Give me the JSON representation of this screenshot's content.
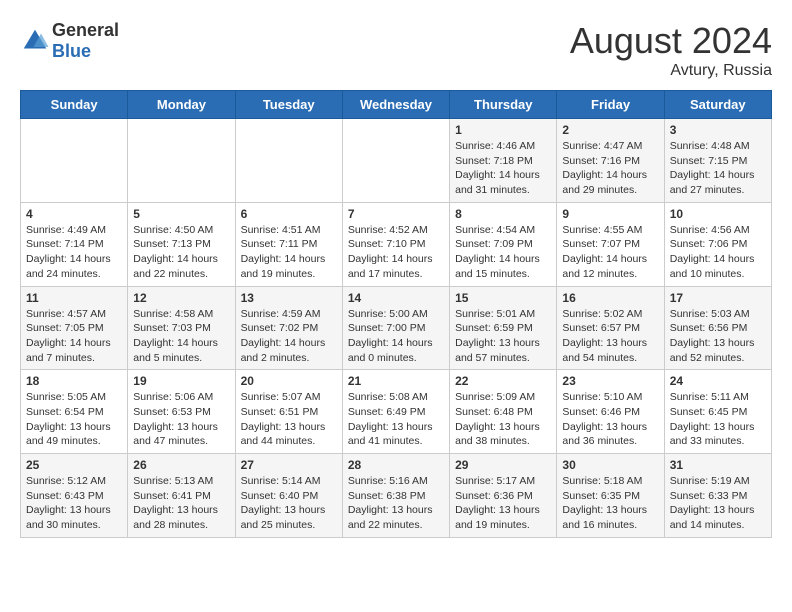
{
  "header": {
    "logo_general": "General",
    "logo_blue": "Blue",
    "month_year": "August 2024",
    "location": "Avtury, Russia"
  },
  "days_of_week": [
    "Sunday",
    "Monday",
    "Tuesday",
    "Wednesday",
    "Thursday",
    "Friday",
    "Saturday"
  ],
  "weeks": [
    [
      {
        "day": "",
        "content": ""
      },
      {
        "day": "",
        "content": ""
      },
      {
        "day": "",
        "content": ""
      },
      {
        "day": "",
        "content": ""
      },
      {
        "day": "1",
        "content": "Sunrise: 4:46 AM\nSunset: 7:18 PM\nDaylight: 14 hours\nand 31 minutes."
      },
      {
        "day": "2",
        "content": "Sunrise: 4:47 AM\nSunset: 7:16 PM\nDaylight: 14 hours\nand 29 minutes."
      },
      {
        "day": "3",
        "content": "Sunrise: 4:48 AM\nSunset: 7:15 PM\nDaylight: 14 hours\nand 27 minutes."
      }
    ],
    [
      {
        "day": "4",
        "content": "Sunrise: 4:49 AM\nSunset: 7:14 PM\nDaylight: 14 hours\nand 24 minutes."
      },
      {
        "day": "5",
        "content": "Sunrise: 4:50 AM\nSunset: 7:13 PM\nDaylight: 14 hours\nand 22 minutes."
      },
      {
        "day": "6",
        "content": "Sunrise: 4:51 AM\nSunset: 7:11 PM\nDaylight: 14 hours\nand 19 minutes."
      },
      {
        "day": "7",
        "content": "Sunrise: 4:52 AM\nSunset: 7:10 PM\nDaylight: 14 hours\nand 17 minutes."
      },
      {
        "day": "8",
        "content": "Sunrise: 4:54 AM\nSunset: 7:09 PM\nDaylight: 14 hours\nand 15 minutes."
      },
      {
        "day": "9",
        "content": "Sunrise: 4:55 AM\nSunset: 7:07 PM\nDaylight: 14 hours\nand 12 minutes."
      },
      {
        "day": "10",
        "content": "Sunrise: 4:56 AM\nSunset: 7:06 PM\nDaylight: 14 hours\nand 10 minutes."
      }
    ],
    [
      {
        "day": "11",
        "content": "Sunrise: 4:57 AM\nSunset: 7:05 PM\nDaylight: 14 hours\nand 7 minutes."
      },
      {
        "day": "12",
        "content": "Sunrise: 4:58 AM\nSunset: 7:03 PM\nDaylight: 14 hours\nand 5 minutes."
      },
      {
        "day": "13",
        "content": "Sunrise: 4:59 AM\nSunset: 7:02 PM\nDaylight: 14 hours\nand 2 minutes."
      },
      {
        "day": "14",
        "content": "Sunrise: 5:00 AM\nSunset: 7:00 PM\nDaylight: 14 hours\nand 0 minutes."
      },
      {
        "day": "15",
        "content": "Sunrise: 5:01 AM\nSunset: 6:59 PM\nDaylight: 13 hours\nand 57 minutes."
      },
      {
        "day": "16",
        "content": "Sunrise: 5:02 AM\nSunset: 6:57 PM\nDaylight: 13 hours\nand 54 minutes."
      },
      {
        "day": "17",
        "content": "Sunrise: 5:03 AM\nSunset: 6:56 PM\nDaylight: 13 hours\nand 52 minutes."
      }
    ],
    [
      {
        "day": "18",
        "content": "Sunrise: 5:05 AM\nSunset: 6:54 PM\nDaylight: 13 hours\nand 49 minutes."
      },
      {
        "day": "19",
        "content": "Sunrise: 5:06 AM\nSunset: 6:53 PM\nDaylight: 13 hours\nand 47 minutes."
      },
      {
        "day": "20",
        "content": "Sunrise: 5:07 AM\nSunset: 6:51 PM\nDaylight: 13 hours\nand 44 minutes."
      },
      {
        "day": "21",
        "content": "Sunrise: 5:08 AM\nSunset: 6:49 PM\nDaylight: 13 hours\nand 41 minutes."
      },
      {
        "day": "22",
        "content": "Sunrise: 5:09 AM\nSunset: 6:48 PM\nDaylight: 13 hours\nand 38 minutes."
      },
      {
        "day": "23",
        "content": "Sunrise: 5:10 AM\nSunset: 6:46 PM\nDaylight: 13 hours\nand 36 minutes."
      },
      {
        "day": "24",
        "content": "Sunrise: 5:11 AM\nSunset: 6:45 PM\nDaylight: 13 hours\nand 33 minutes."
      }
    ],
    [
      {
        "day": "25",
        "content": "Sunrise: 5:12 AM\nSunset: 6:43 PM\nDaylight: 13 hours\nand 30 minutes."
      },
      {
        "day": "26",
        "content": "Sunrise: 5:13 AM\nSunset: 6:41 PM\nDaylight: 13 hours\nand 28 minutes."
      },
      {
        "day": "27",
        "content": "Sunrise: 5:14 AM\nSunset: 6:40 PM\nDaylight: 13 hours\nand 25 minutes."
      },
      {
        "day": "28",
        "content": "Sunrise: 5:16 AM\nSunset: 6:38 PM\nDaylight: 13 hours\nand 22 minutes."
      },
      {
        "day": "29",
        "content": "Sunrise: 5:17 AM\nSunset: 6:36 PM\nDaylight: 13 hours\nand 19 minutes."
      },
      {
        "day": "30",
        "content": "Sunrise: 5:18 AM\nSunset: 6:35 PM\nDaylight: 13 hours\nand 16 minutes."
      },
      {
        "day": "31",
        "content": "Sunrise: 5:19 AM\nSunset: 6:33 PM\nDaylight: 13 hours\nand 14 minutes."
      }
    ]
  ]
}
